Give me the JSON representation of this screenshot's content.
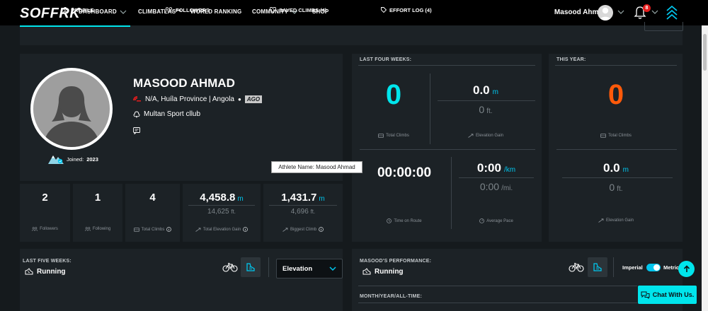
{
  "nav": {
    "logo": "SOFFRK",
    "items": [
      {
        "label": "DASHBOARD",
        "has_menu": true
      },
      {
        "label": "CLIMBATLAS™",
        "has_menu": false
      },
      {
        "label": "WORLD RANKING",
        "has_menu": false
      },
      {
        "label": "COMMUNITY",
        "has_menu": true
      },
      {
        "label": "SHOP",
        "has_menu": false
      }
    ],
    "username": "Masood Ahmad",
    "notification_count": "8"
  },
  "tabs": [
    {
      "label": "PROFILE",
      "icon": "user-icon",
      "active": true
    },
    {
      "label": "FOLLOWERS",
      "icon": "followers-icon",
      "active": false
    },
    {
      "label": "SAVED CLIMBS (4)",
      "icon": "heart-icon",
      "active": false
    },
    {
      "label": "EFFORT LOG (4)",
      "icon": "tag-icon",
      "active": false
    }
  ],
  "profile": {
    "name": "MASOOD AHMAD",
    "location": "N/A, Huíla Province | Angola",
    "country_code": "AGO",
    "club": "Multan Sport cllub",
    "joined_label": "Joined:",
    "joined_year": "2023"
  },
  "stats": [
    {
      "value": "2",
      "unit": "",
      "sub": "",
      "sub_unit": "",
      "label": "Followers",
      "icon": "followers-icon",
      "info": false
    },
    {
      "value": "1",
      "unit": "",
      "sub": "",
      "sub_unit": "",
      "label": "Following",
      "icon": "following-icon",
      "info": false
    },
    {
      "value": "4",
      "unit": "",
      "sub": "",
      "sub_unit": "",
      "label": "Total Climbs",
      "icon": "climbs-icon",
      "info": true
    },
    {
      "value": "4,458.8",
      "unit": "m",
      "sub": "14,625",
      "sub_unit": "ft.",
      "label": "Total Elevation Gain",
      "icon": "elevation-icon",
      "info": true
    },
    {
      "value": "1,431.7",
      "unit": "m",
      "sub": "4,696",
      "sub_unit": "ft.",
      "label": "Biggest Climb",
      "icon": "elevation-icon",
      "info": true
    }
  ],
  "tooltip": "Athlete Name: Masood Ahmad",
  "last_four_weeks": {
    "title": "LAST FOUR WEEKS:",
    "total_climbs": "0",
    "total_climbs_label": "Total Climbs",
    "elevation_m": "0.0",
    "elevation_m_unit": "m",
    "elevation_ft": "0",
    "elevation_ft_unit": "ft.",
    "elevation_label": "Elevation Gain",
    "time": "00:00:00",
    "time_label": "Time on Route",
    "pace_km": "0:00",
    "pace_km_unit": "/km",
    "pace_mi": "0:00",
    "pace_mi_unit": "/mi.",
    "pace_label": "Average Pace"
  },
  "this_year": {
    "title": "THIS YEAR:",
    "total_climbs": "0",
    "total_climbs_label": "Total Climbs",
    "elevation_m": "0.0",
    "elevation_m_unit": "m",
    "elevation_ft": "0",
    "elevation_ft_unit": "ft.",
    "elevation_label": "Elevation Gain"
  },
  "last_five_weeks": {
    "title": "LAST FIVE WEEKS:",
    "sport": "Running",
    "select_value": "Elevation"
  },
  "performance": {
    "title": "MASOOD'S PERFORMANCE:",
    "sport": "Running",
    "toggle_left": "Imperial",
    "toggle_right": "Metric",
    "subtitle": "MONTH/YEAR/ALL-TIME:"
  },
  "chat_label": "Chat With Us.",
  "colors": {
    "accent": "#00e5ec",
    "orange": "#ff5a0a",
    "panel": "#1c2226",
    "background": "#151a1d"
  }
}
